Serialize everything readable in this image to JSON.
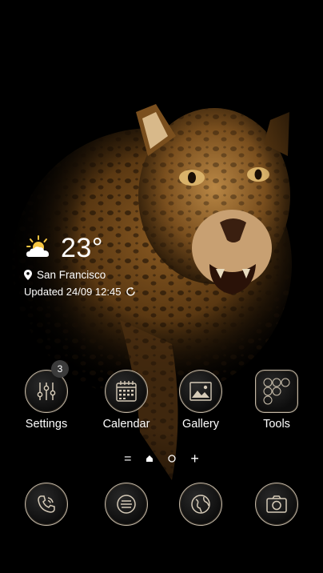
{
  "weather": {
    "temperature": "23°",
    "location": "San Francisco",
    "updated": "Updated 24/09 12:45",
    "icon": "partly-sunny-icon"
  },
  "apps": [
    {
      "label": "Settings",
      "icon": "settings-sliders-icon",
      "badge": "3"
    },
    {
      "label": "Calendar",
      "icon": "calendar-icon"
    },
    {
      "label": "Gallery",
      "icon": "gallery-icon"
    },
    {
      "label": "Tools",
      "icon": "tools-folder-icon"
    }
  ],
  "pager": {
    "menu": "=",
    "add": "+"
  },
  "dock": [
    {
      "icon": "phone-icon"
    },
    {
      "icon": "messages-icon"
    },
    {
      "icon": "browser-icon"
    },
    {
      "icon": "camera-icon"
    }
  ],
  "colors": {
    "ring": "#c2b7a6",
    "background": "#000000",
    "text": "#ffffff"
  }
}
